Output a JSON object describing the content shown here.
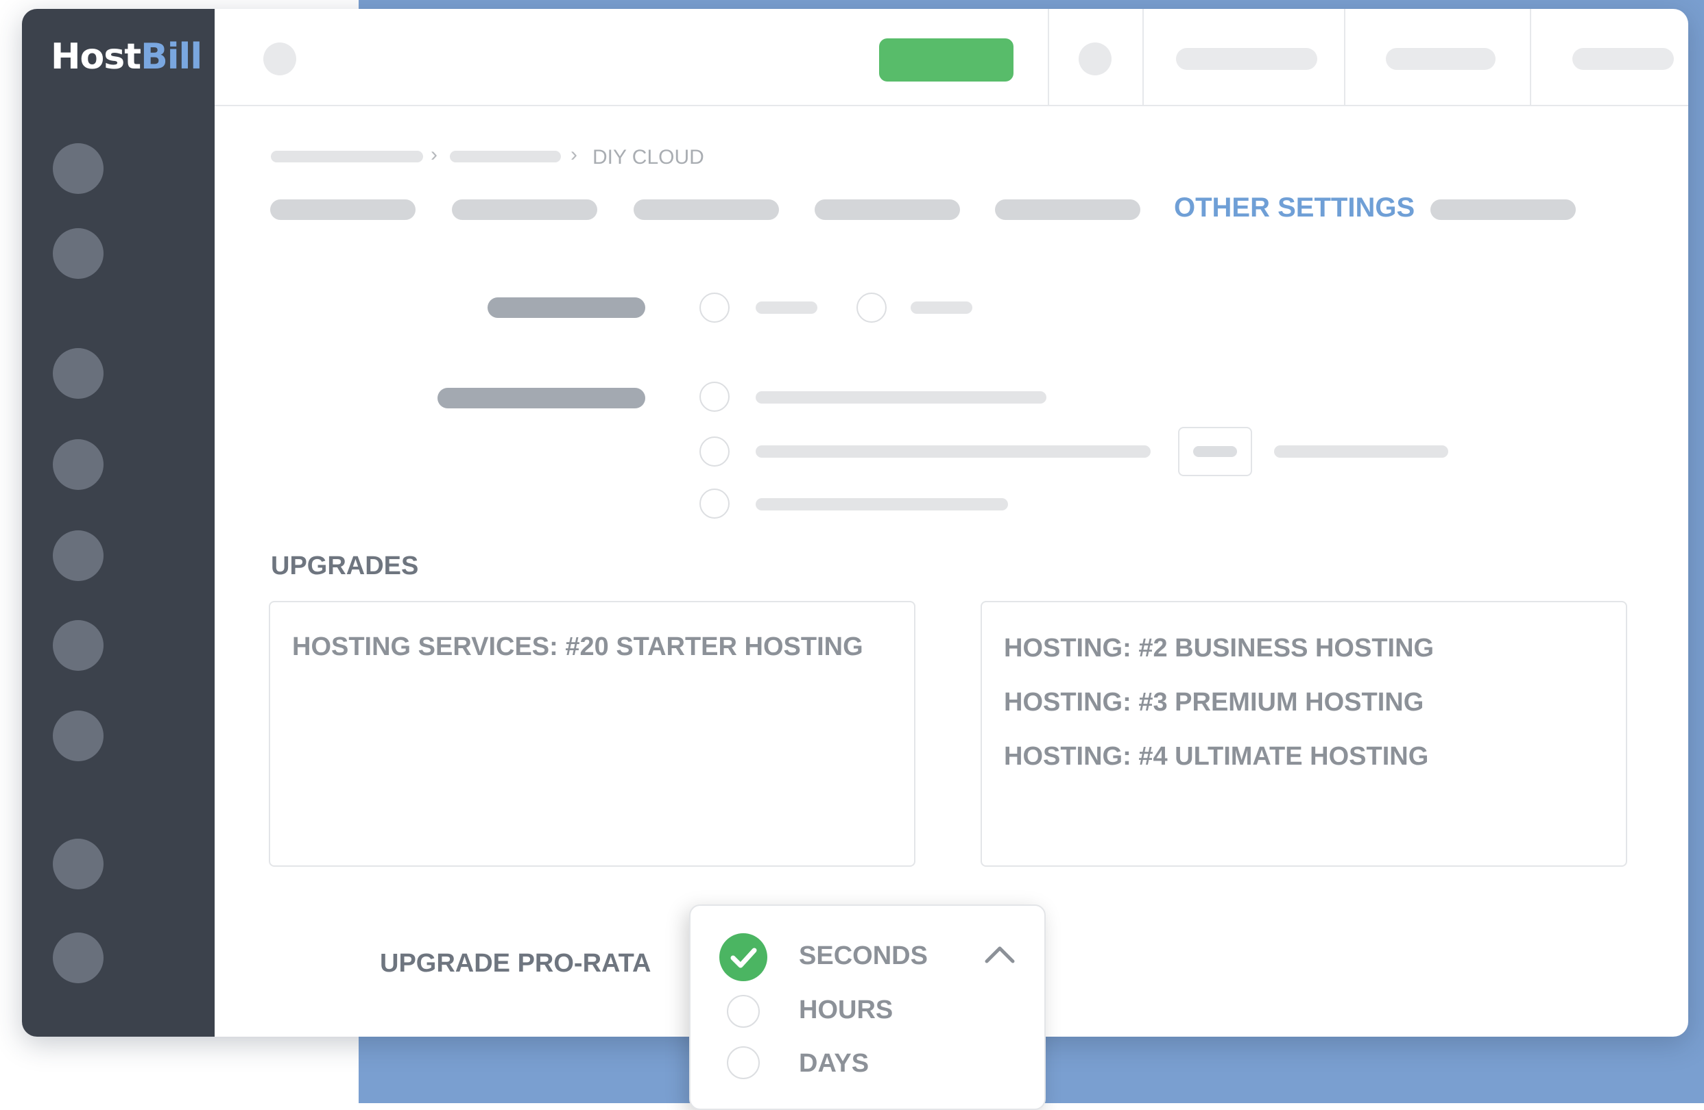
{
  "app": {
    "logo_host": "Host",
    "logo_bill": "Bill"
  },
  "breadcrumb": {
    "current": "DIY CLOUD"
  },
  "tabs": {
    "active_label": "OTHER SETTINGS"
  },
  "upgrades": {
    "title": "UPGRADES",
    "source_items": [
      "HOSTING SERVICES: #20 STARTER HOSTING"
    ],
    "target_items": [
      "HOSTING: #2 BUSINESS HOSTING",
      "HOSTING: #3 PREMIUM HOSTING",
      "HOSTING: #4 ULTIMATE HOSTING"
    ]
  },
  "prorata": {
    "label": "UPGRADE PRO-RATA",
    "options": [
      "SECONDS",
      "HOURS",
      "DAYS"
    ],
    "selected": "SECONDS"
  },
  "colors": {
    "sidebar": "#3c424c",
    "accent_blue": "#6f9fd6",
    "green": "#58bc6a",
    "background_blue": "#7a9fd0"
  },
  "icons": {
    "check": "check-circle-icon",
    "caret": "chevron-up-icon"
  }
}
